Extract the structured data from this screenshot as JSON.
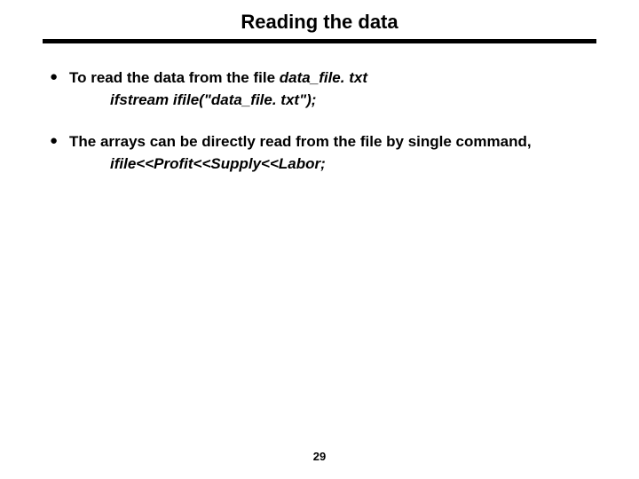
{
  "title": "Reading the data",
  "bullets": [
    {
      "text_pre": "To read the data from the file ",
      "text_italic": "data_file. txt",
      "code": "ifstream ifile(\"data_file. txt\");"
    },
    {
      "text_pre": "The arrays can be directly read from the file by single command,",
      "text_italic": "",
      "code": "ifile<<Profit<<Supply<<Labor;"
    }
  ],
  "page_number": "29"
}
